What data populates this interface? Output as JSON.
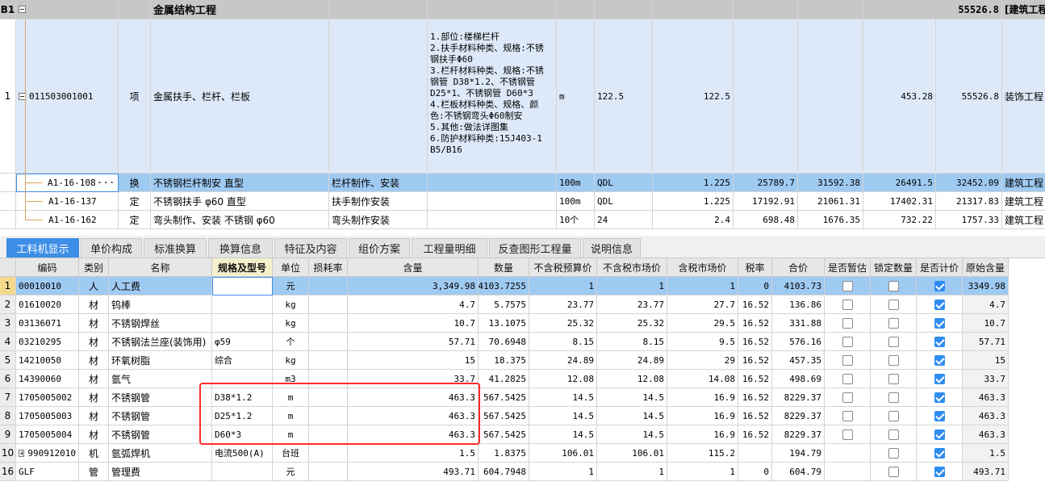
{
  "upper": {
    "group_row": {
      "row_no": "B1",
      "name": "金属结构工程",
      "total": "55526.8",
      "specialty": "[建筑工程"
    },
    "item_row": {
      "row_no": "1",
      "code": "011503001001",
      "type": "项",
      "name": "金属扶手、栏杆、栏板",
      "features": "1.部位:楼梯栏杆\n2.扶手材料种类、规格:不锈\n钢扶手Φ60\n3.栏杆材料种类、规格:不锈\n钢管 D38*1.2、不锈钢管\nD25*1、不锈钢管 D60*3\n4.栏板材料种类、规格、颜\n色:不锈钢弯头Φ60制安\n5.其他:做法详图集\n6.防护材料种类:15J403-1\nB5/B16",
      "unit": "m",
      "expr": "122.5",
      "qty": "122.5",
      "unit_price": "453.28",
      "total": "55526.8",
      "specialty": "装饰工程"
    },
    "quota_rows": [
      {
        "code": "A1-16-108",
        "type": "换",
        "name": "不锈钢栏杆制安 直型",
        "content": "栏杆制作、安装",
        "unit": "100m",
        "expr": "QDL",
        "qty": "1.225",
        "price1": "25789.7",
        "price2": "31592.38",
        "price3": "26491.5",
        "price4": "32452.09",
        "specialty": "建筑工程"
      },
      {
        "code": "A1-16-137",
        "type": "定",
        "name": "不锈钢扶手 φ60 直型",
        "content": "扶手制作安装",
        "unit": "100m",
        "expr": "QDL",
        "qty": "1.225",
        "price1": "17192.91",
        "price2": "21061.31",
        "price3": "17402.31",
        "price4": "21317.83",
        "specialty": "建筑工程"
      },
      {
        "code": "A1-16-162",
        "type": "定",
        "name": "弯头制作、安装 不锈钢 φ60",
        "content": "弯头制作安装",
        "unit": "10个",
        "expr": "24",
        "qty": "2.4",
        "price1": "698.48",
        "price2": "1676.35",
        "price3": "732.22",
        "price4": "1757.33",
        "specialty": "建筑工程"
      }
    ]
  },
  "tabs": [
    "工料机显示",
    "单价构成",
    "标准换算",
    "换算信息",
    "特征及内容",
    "组价方案",
    "工程量明细",
    "反查图形工程量",
    "说明信息"
  ],
  "lower": {
    "headers": [
      "编码",
      "类别",
      "名称",
      "规格及型号",
      "单位",
      "损耗率",
      "含量",
      "数量",
      "不含税预算价",
      "不含税市场价",
      "含税市场价",
      "税率",
      "合价",
      "是否暂估",
      "锁定数量",
      "是否计价",
      "原始含量"
    ],
    "rows": [
      {
        "no": "1",
        "code": "00010010",
        "cat": "人",
        "name": "人工费",
        "spec": "",
        "unit": "元",
        "loss": "",
        "content": "3,349.98",
        "qty": "4103.7255",
        "p1": "1",
        "p2": "1",
        "p3": "1",
        "tax": "0",
        "total": "4103.73",
        "temp": false,
        "lock": false,
        "priced": true,
        "orig": "3349.98"
      },
      {
        "no": "2",
        "code": "01610020",
        "cat": "材",
        "name": "钨棒",
        "spec": "",
        "unit": "kg",
        "loss": "",
        "content": "4.7",
        "qty": "5.7575",
        "p1": "23.77",
        "p2": "23.77",
        "p3": "27.7",
        "tax": "16.52",
        "total": "136.86",
        "temp": false,
        "lock": false,
        "priced": true,
        "orig": "4.7"
      },
      {
        "no": "3",
        "code": "03136071",
        "cat": "材",
        "name": "不锈钢焊丝",
        "spec": "",
        "unit": "kg",
        "loss": "",
        "content": "10.7",
        "qty": "13.1075",
        "p1": "25.32",
        "p2": "25.32",
        "p3": "29.5",
        "tax": "16.52",
        "total": "331.88",
        "temp": false,
        "lock": false,
        "priced": true,
        "orig": "10.7"
      },
      {
        "no": "4",
        "code": "03210295",
        "cat": "材",
        "name": "不锈钢法兰座(装饰用)",
        "spec": "φ59",
        "unit": "个",
        "loss": "",
        "content": "57.71",
        "qty": "70.6948",
        "p1": "8.15",
        "p2": "8.15",
        "p3": "9.5",
        "tax": "16.52",
        "total": "576.16",
        "temp": false,
        "lock": false,
        "priced": true,
        "orig": "57.71"
      },
      {
        "no": "5",
        "code": "14210050",
        "cat": "材",
        "name": "环氧树脂",
        "spec": "综合",
        "unit": "kg",
        "loss": "",
        "content": "15",
        "qty": "18.375",
        "p1": "24.89",
        "p2": "24.89",
        "p3": "29",
        "tax": "16.52",
        "total": "457.35",
        "temp": false,
        "lock": false,
        "priced": true,
        "orig": "15"
      },
      {
        "no": "6",
        "code": "14390060",
        "cat": "材",
        "name": "氩气",
        "spec": "",
        "unit": "m3",
        "loss": "",
        "content": "33.7",
        "qty": "41.2825",
        "p1": "12.08",
        "p2": "12.08",
        "p3": "14.08",
        "tax": "16.52",
        "total": "498.69",
        "temp": false,
        "lock": false,
        "priced": true,
        "orig": "33.7"
      },
      {
        "no": "7",
        "code": "1705005002",
        "cat": "材",
        "name": "不锈钢管",
        "spec": "D38*1.2",
        "unit": "m",
        "loss": "",
        "content": "463.3",
        "qty": "567.5425",
        "p1": "14.5",
        "p2": "14.5",
        "p3": "16.9",
        "tax": "16.52",
        "total": "8229.37",
        "temp": false,
        "lock": false,
        "priced": true,
        "orig": "463.3"
      },
      {
        "no": "8",
        "code": "1705005003",
        "cat": "材",
        "name": "不锈钢管",
        "spec": "D25*1.2",
        "unit": "m",
        "loss": "",
        "content": "463.3",
        "qty": "567.5425",
        "p1": "14.5",
        "p2": "14.5",
        "p3": "16.9",
        "tax": "16.52",
        "total": "8229.37",
        "temp": false,
        "lock": false,
        "priced": true,
        "orig": "463.3"
      },
      {
        "no": "9",
        "code": "1705005004",
        "cat": "材",
        "name": "不锈钢管",
        "spec": "D60*3",
        "unit": "m",
        "loss": "",
        "content": "463.3",
        "qty": "567.5425",
        "p1": "14.5",
        "p2": "14.5",
        "p3": "16.9",
        "tax": "16.52",
        "total": "8229.37",
        "temp": false,
        "lock": false,
        "priced": true,
        "orig": "463.3"
      },
      {
        "no": "10",
        "code": "990912010",
        "cat": "机",
        "name": "氩弧焊机",
        "spec": "电流500(A)",
        "unit": "台班",
        "loss": "",
        "content": "1.5",
        "qty": "1.8375",
        "p1": "106.01",
        "p2": "106.01",
        "p3": "115.2",
        "tax": "",
        "total": "194.79",
        "temp": null,
        "lock": false,
        "priced": true,
        "orig": "1.5"
      },
      {
        "no": "16",
        "code": "GLF",
        "cat": "管",
        "name": "管理费",
        "spec": "",
        "unit": "元",
        "loss": "",
        "content": "493.71",
        "qty": "604.7948",
        "p1": "1",
        "p2": "1",
        "p3": "1",
        "tax": "0",
        "total": "604.79",
        "temp": null,
        "lock": false,
        "priced": true,
        "orig": "493.71"
      }
    ]
  },
  "colors": {
    "selected_row": "#9fcaf2",
    "active_tab": "#3d8ee6",
    "highlight_box": "#ff2a2a",
    "group_row": "#c7c7c7"
  }
}
